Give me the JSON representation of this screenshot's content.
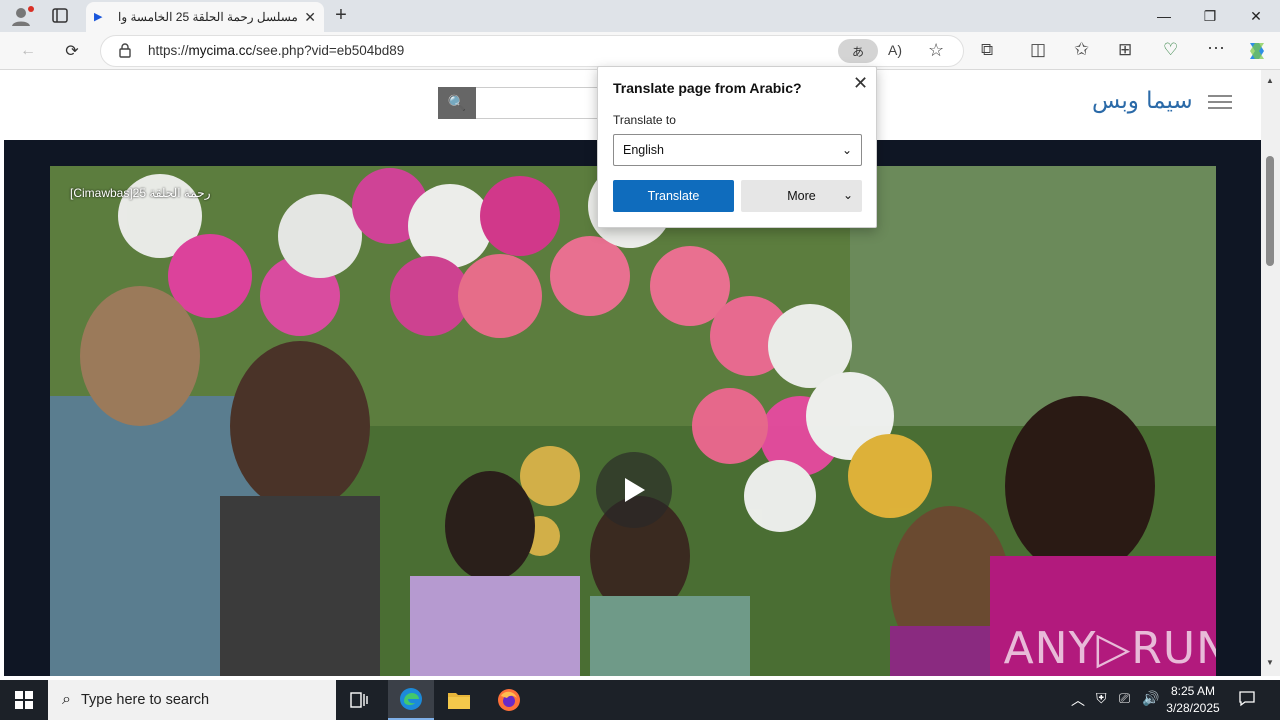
{
  "browser": {
    "tab_title": "مسلسل رحمة الحلقة 25 الخامسة وا",
    "url_scheme": "https://",
    "url_host": "mycima.cc",
    "url_path": "/see.php?vid=eb504bd89",
    "translate_pill": "あ"
  },
  "site": {
    "logo_text": "سيما وبس",
    "video_title": "[Cimawbas]25 رحمة الحلقة",
    "watermark": "ANY▷RUN"
  },
  "translate_popup": {
    "title": "Translate page from Arabic?",
    "label": "Translate to",
    "selected_language": "English",
    "translate_button": "Translate",
    "more_button": "More"
  },
  "taskbar": {
    "search_placeholder": "Type here to search",
    "time": "8:25 AM",
    "date": "3/28/2025"
  },
  "colors": {
    "accent": "#0f6cbd",
    "logo": "#2b6aa8",
    "taskbar": "#1c2128"
  }
}
